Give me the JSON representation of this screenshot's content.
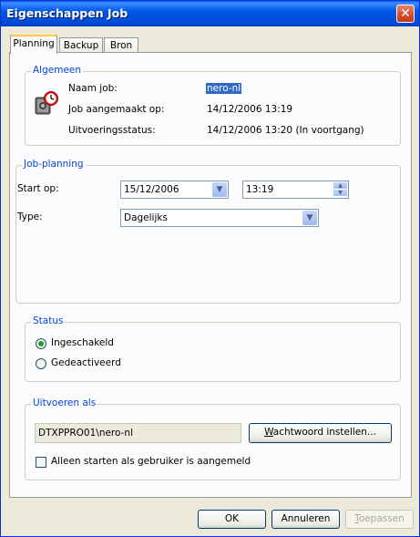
{
  "window": {
    "title": "Eigenschappen Job",
    "close_glyph": "✕"
  },
  "tabs": [
    "Planning",
    "Backup",
    "Bron"
  ],
  "algemeen": {
    "legend": "Algemeen",
    "naam_label": "Naam job:",
    "naam_value": "nero-nl",
    "aangemaakt_label": "Job aangemaakt op:",
    "aangemaakt_value": "14/12/2006 13:19",
    "status_label": "Uitvoeringsstatus:",
    "status_value": "14/12/2006 13:20 (In voortgang)",
    "icon": "scheduled-job-clock-icon"
  },
  "planning": {
    "legend": "Job-planning",
    "start_label": "Start op:",
    "start_date": "15/12/2006",
    "start_time": "13:19",
    "type_label": "Type:",
    "type_value": "Dagelijks"
  },
  "status": {
    "legend": "Status",
    "enabled_label": "Ingeschakeld",
    "disabled_label": "Gedeactiveerd",
    "selected": "Ingeschakeld"
  },
  "uitvoeren": {
    "legend": "Uitvoeren als",
    "account": "DTXPPRO01\\nero-nl",
    "password_btn_prefix": "W",
    "password_btn_rest": "achtwoord instellen...",
    "only_logged_label": "Alleen starten als gebruiker is aangemeld",
    "only_logged_checked": false
  },
  "buttons": {
    "ok": "OK",
    "cancel": "Annuleren",
    "apply_prefix": "T",
    "apply_rest": "oepassen"
  }
}
